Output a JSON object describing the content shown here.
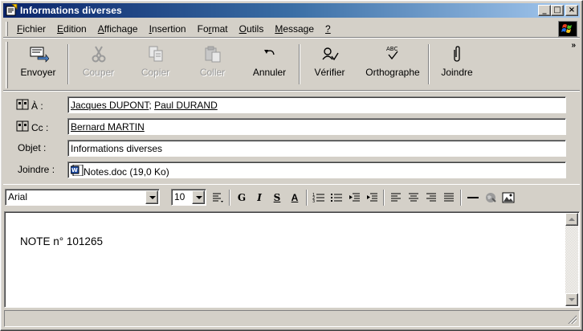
{
  "window": {
    "title": "Informations diverses"
  },
  "menubar": {
    "items": [
      {
        "pre": "",
        "u": "F",
        "post": "ichier"
      },
      {
        "pre": "",
        "u": "E",
        "post": "dition"
      },
      {
        "pre": "",
        "u": "A",
        "post": "ffichage"
      },
      {
        "pre": "",
        "u": "I",
        "post": "nsertion"
      },
      {
        "pre": "Fo",
        "u": "r",
        "post": "mat"
      },
      {
        "pre": "",
        "u": "O",
        "post": "utils"
      },
      {
        "pre": "",
        "u": "M",
        "post": "essage"
      },
      {
        "pre": "",
        "u": "?",
        "post": ""
      }
    ]
  },
  "toolbar": {
    "send": "Envoyer",
    "cut": "Couper",
    "copy": "Copier",
    "paste": "Coller",
    "undo": "Annuler",
    "check": "Vérifier",
    "spelling": "Orthographe",
    "attach": "Joindre",
    "more": "»"
  },
  "fields": {
    "to_label": "À :",
    "to_values": [
      "Jacques DUPONT",
      "Paul DURAND"
    ],
    "to_separator": ";",
    "cc_label": "Cc :",
    "cc_value": "Bernard MARTIN",
    "subject_label": "Objet :",
    "subject_value": "Informations diverses",
    "attach_label": "Joindre :",
    "attach_value": "Notes.doc (19,0 Ko)"
  },
  "format": {
    "font": "Arial",
    "size": "10",
    "bold": "G",
    "italic": "I",
    "underline": "S",
    "color": "A"
  },
  "body": {
    "text": "NOTE n° 101265"
  }
}
